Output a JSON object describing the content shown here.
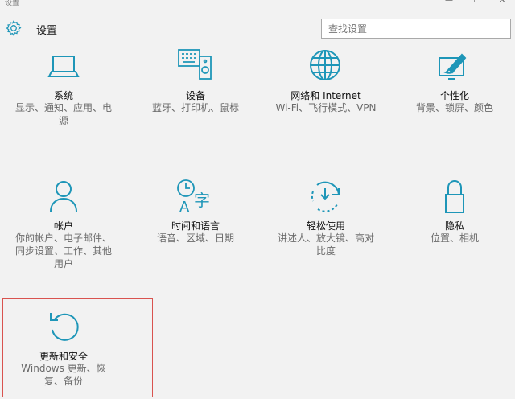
{
  "window": {
    "title": "设置",
    "minimize": "—",
    "maximize": "☐",
    "close": "✕"
  },
  "header": {
    "title": "设置",
    "icon": "gear-icon"
  },
  "search": {
    "placeholder": "查找设置"
  },
  "accent_color": "#1e96b8",
  "highlight_color": "#d9534f",
  "tiles": [
    {
      "icon": "laptop-icon",
      "title": "系统",
      "desc": [
        "显示、通知、应用、电",
        "源"
      ]
    },
    {
      "icon": "devices-icon",
      "title": "设备",
      "desc": [
        "蓝牙、打印机、鼠标"
      ]
    },
    {
      "icon": "globe-icon",
      "title": "网络和 Internet",
      "desc": [
        "Wi-Fi、飞行模式、VPN"
      ]
    },
    {
      "icon": "personalization-icon",
      "title": "个性化",
      "desc": [
        "背景、锁屏、颜色"
      ]
    },
    {
      "icon": "person-icon",
      "title": "帐户",
      "desc": [
        "你的帐户、电子邮件、",
        "同步设置、工作、其他",
        "用户"
      ]
    },
    {
      "icon": "time-language-icon",
      "title": "时间和语言",
      "desc": [
        "语音、区域、日期"
      ]
    },
    {
      "icon": "ease-of-access-icon",
      "title": "轻松使用",
      "desc": [
        "讲述人、放大镜、高对",
        "比度"
      ]
    },
    {
      "icon": "lock-icon",
      "title": "隐私",
      "desc": [
        "位置、相机"
      ]
    },
    {
      "icon": "update-icon",
      "title": "更新和安全",
      "desc": [
        "Windows 更新、恢",
        "复、备份"
      ]
    }
  ]
}
